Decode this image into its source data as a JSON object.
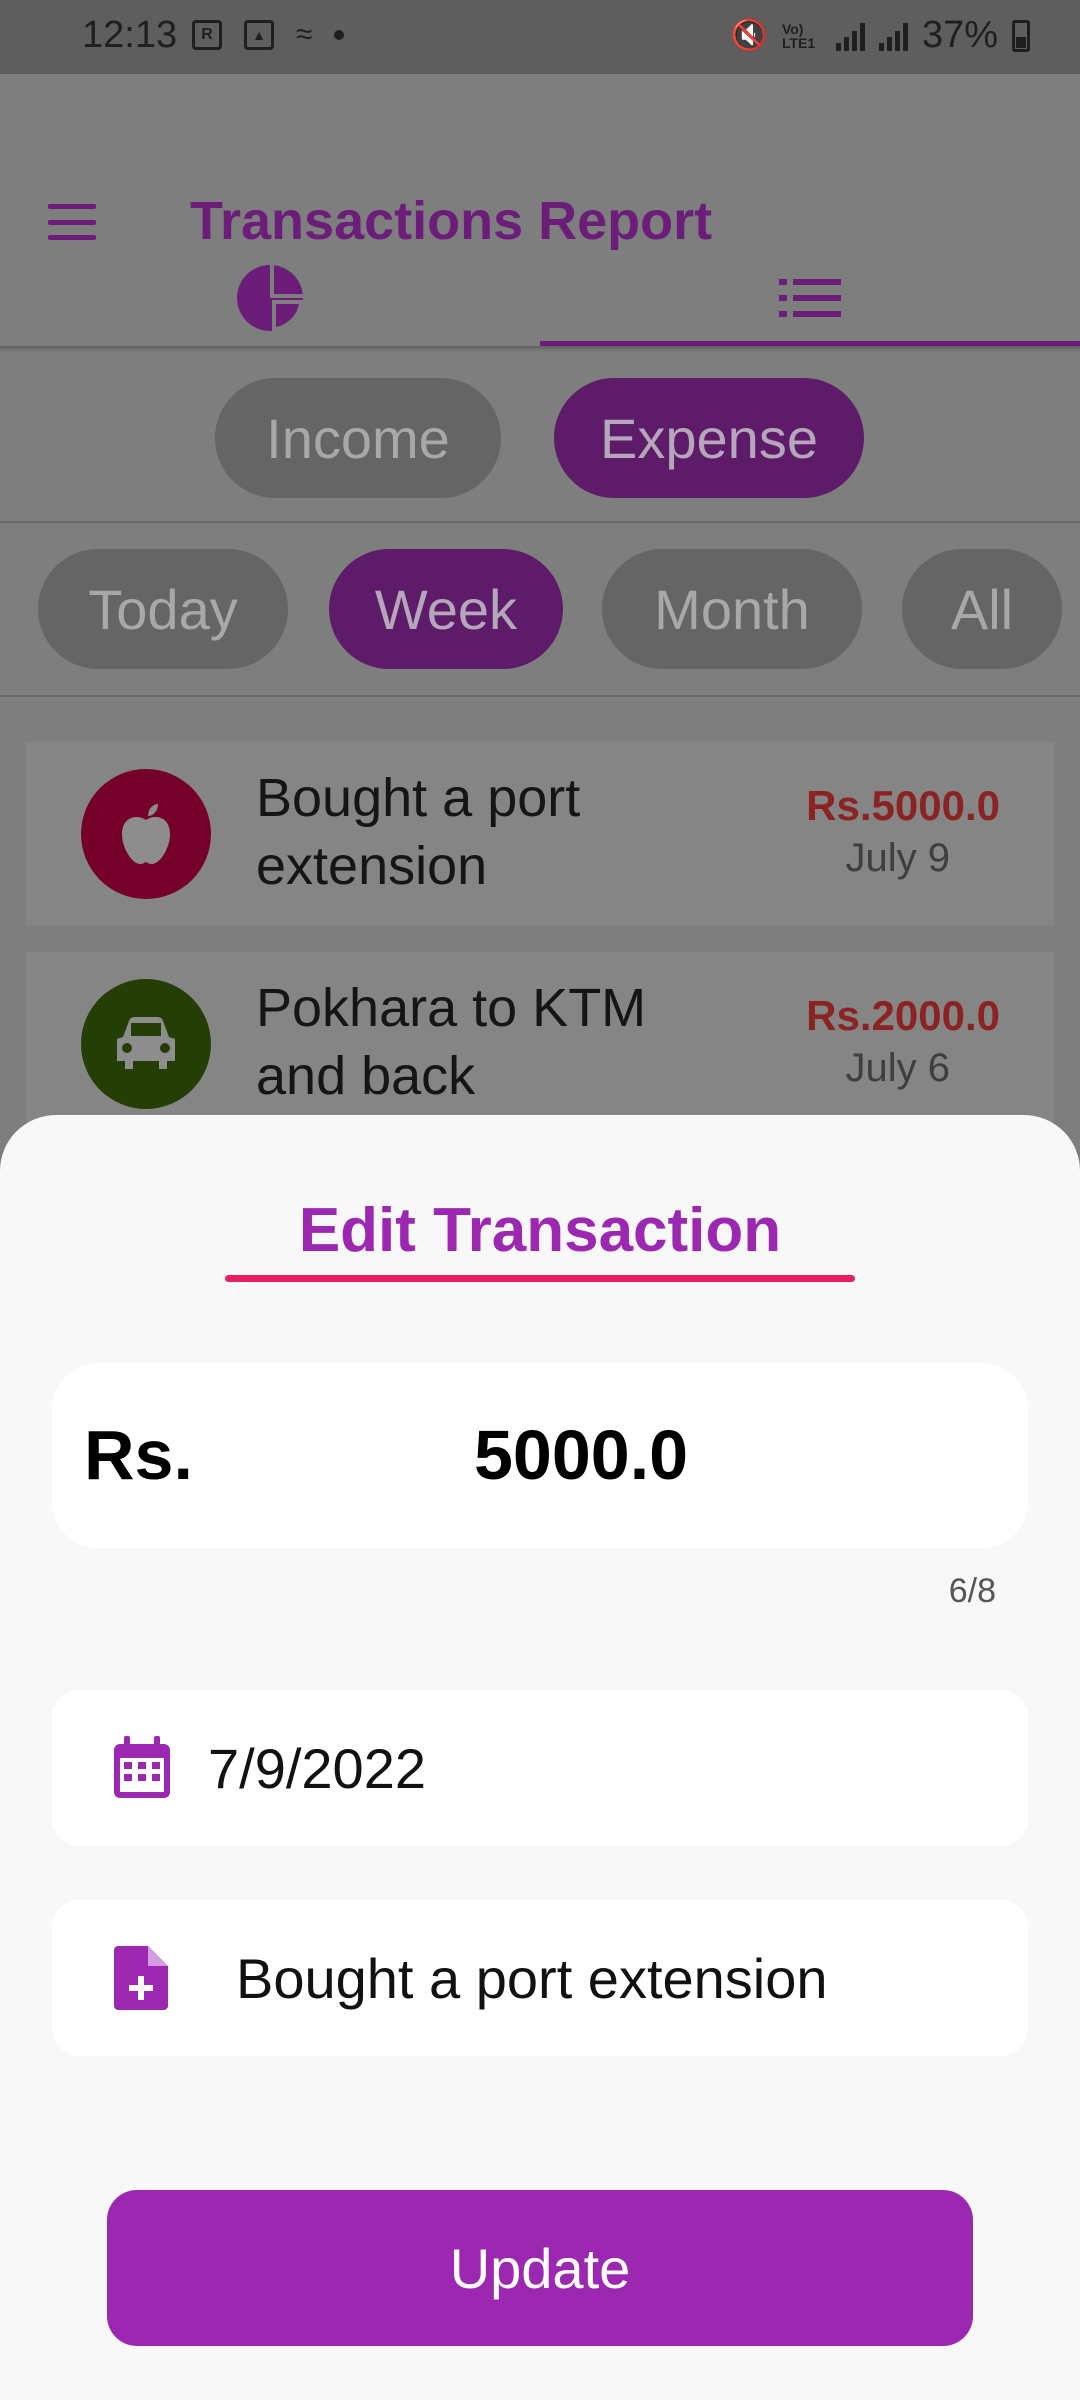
{
  "status_bar": {
    "time": "12:13",
    "battery": "37%",
    "network": "Vo) LTE1"
  },
  "app": {
    "title": "Transactions Report",
    "accent_color": "#9c27b0"
  },
  "tabs": [
    {
      "icon": "pie-chart-icon"
    },
    {
      "icon": "list-icon",
      "selected": true
    }
  ],
  "type_filter": {
    "options": [
      "Income",
      "Expense"
    ],
    "selected": "Expense"
  },
  "period_filter": {
    "options": [
      "Today",
      "Week",
      "Month",
      "All"
    ],
    "selected": "Week"
  },
  "transactions": [
    {
      "title": "Bought a port extension",
      "amount": "Rs.5000.0",
      "date": "July 9",
      "icon": "apple-icon",
      "icon_color": "#e8004b"
    },
    {
      "title": "Pokhara to KTM and back",
      "amount": "Rs.2000.0",
      "date": "July 6",
      "icon": "car-icon",
      "icon_color": "#4a7d0a"
    }
  ],
  "edit_sheet": {
    "title": "Edit Transaction",
    "currency_prefix": "Rs.",
    "amount": "5000.0",
    "char_counter": "6/8",
    "date": "7/9/2022",
    "note": "Bought a port extension",
    "update_label": "Update"
  }
}
